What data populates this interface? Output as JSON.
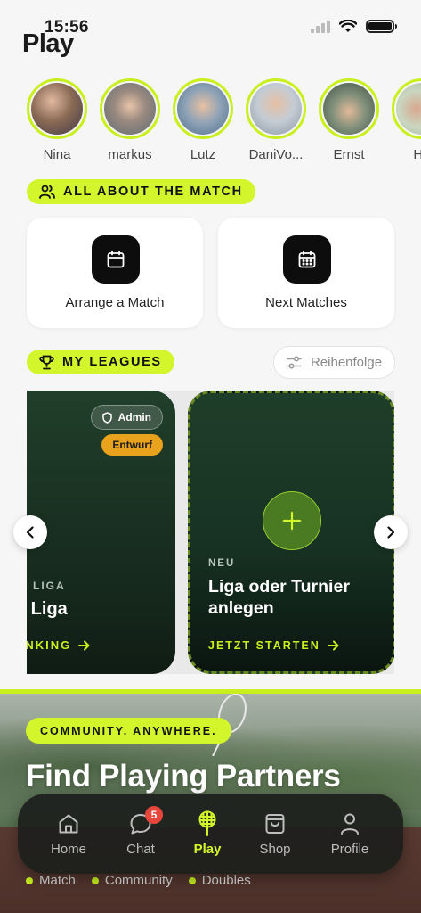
{
  "status_bar": {
    "time": "15:56"
  },
  "header": {
    "title": "Play"
  },
  "stories": [
    {
      "name": "Nina",
      "avatar_color": "#8a6a55"
    },
    {
      "name": "markus",
      "avatar_color": "#7c8a8f"
    },
    {
      "name": "Lutz",
      "avatar_color": "#6f8da8"
    },
    {
      "name": "DaniVo...",
      "avatar_color": "#9aa7b4"
    },
    {
      "name": "Ernst",
      "avatar_color": "#6a7f6c"
    },
    {
      "name": "He",
      "avatar_color": "#b9c9b2"
    }
  ],
  "match_section": {
    "title": "ALL ABOUT THE MATCH",
    "tiles": [
      {
        "label": "Arrange a Match",
        "icon": "calendar-icon"
      },
      {
        "label": "Next Matches",
        "icon": "calendar-grid-icon"
      }
    ]
  },
  "leagues_section": {
    "title": "MY LEAGUES",
    "sort_button": "Reihenfolge",
    "cards": [
      {
        "admin_badge": "Admin",
        "status_badge": "Entwurf",
        "kicker": "LIGA",
        "name": "e Liga",
        "cta": "ANKING"
      },
      {
        "kicker": "NEU",
        "name": "Liga oder Turnier anlegen",
        "cta": "JETZT STARTEN"
      }
    ]
  },
  "promo": {
    "badge": "COMMUNITY. ANYWHERE.",
    "title": "Find Playing Partners",
    "tags": [
      "Match",
      "Community",
      "Doubles"
    ]
  },
  "tabbar": {
    "tabs": [
      {
        "label": "Home",
        "icon": "home-icon"
      },
      {
        "label": "Chat",
        "icon": "chat-icon",
        "badge": "5"
      },
      {
        "label": "Play",
        "icon": "tennis-racket-icon",
        "active": true
      },
      {
        "label": "Shop",
        "icon": "shopping-bag-icon"
      },
      {
        "label": "Profile",
        "icon": "user-icon"
      }
    ]
  },
  "colors": {
    "accent": "#d3f52b",
    "dark_card": "#1f3e29",
    "draft": "#e8a21d",
    "badge": "#e8453c"
  }
}
